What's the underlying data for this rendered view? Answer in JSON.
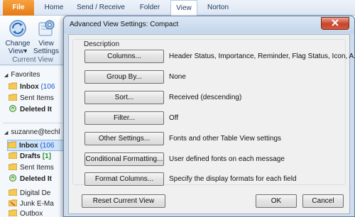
{
  "ribbon": {
    "tabs": [
      "File",
      "Home",
      "Send / Receive",
      "Folder",
      "View",
      "Norton"
    ],
    "buttons": {
      "change_view": "Change View",
      "change_view_dropdown": "▾",
      "view_settings": "View Settings"
    },
    "group_label": "Current View"
  },
  "nav": {
    "favorites_header": "Favorites",
    "favorites": [
      {
        "label": "Inbox",
        "count": "(106"
      },
      {
        "label": "Sent Items",
        "count": ""
      },
      {
        "label": "Deleted It",
        "count": ""
      }
    ],
    "account_header": "suzanne@techl",
    "account_items": [
      {
        "label": "Inbox",
        "count": "(106"
      },
      {
        "label": "Drafts",
        "count": "[1]"
      },
      {
        "label": "Sent Items",
        "count": ""
      },
      {
        "label": "Deleted It",
        "count": ""
      },
      {
        "label": "Digital De",
        "count": ""
      },
      {
        "label": "Junk E-Ma",
        "count": ""
      },
      {
        "label": "Outbox",
        "count": ""
      }
    ]
  },
  "dialog": {
    "title": "Advanced View Settings: Compact",
    "description_label": "Description",
    "rows": [
      {
        "button": "Columns...",
        "value": "Header Status, Importance, Reminder, Flag Status, Icon, A..."
      },
      {
        "button": "Group By...",
        "value": "None"
      },
      {
        "button": "Sort...",
        "value": "Received (descending)"
      },
      {
        "button": "Filter...",
        "value": "Off"
      },
      {
        "button": "Other Settings...",
        "value": "Fonts and other Table View settings"
      },
      {
        "button": "Conditional Formatting...",
        "value": "User defined fonts on each message"
      },
      {
        "button": "Format Columns...",
        "value": "Specify the display formats for each field"
      }
    ],
    "reset_button": "Reset Current View",
    "ok_button": "OK",
    "cancel_button": "Cancel"
  },
  "colors": {
    "file_tab": "#e57a16",
    "count_blue": "#1b55c5",
    "close_red": "#c7432a"
  }
}
